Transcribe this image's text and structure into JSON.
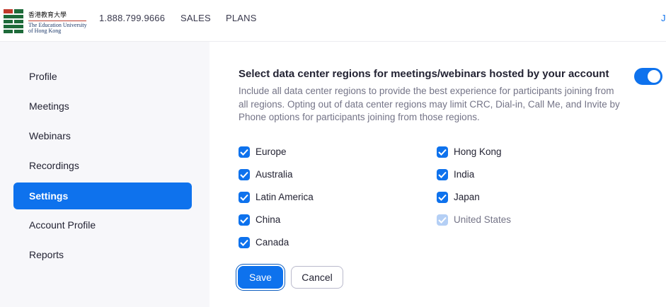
{
  "header": {
    "logo_cn": "香港教育大學",
    "logo_en_line1": "The Education University",
    "logo_en_line2": "of Hong Kong",
    "phone": "1.888.799.9666",
    "sales": "SALES",
    "plans": "PLANS",
    "user_initial": "J"
  },
  "sidebar": {
    "items": [
      {
        "label": "Profile",
        "active": false
      },
      {
        "label": "Meetings",
        "active": false
      },
      {
        "label": "Webinars",
        "active": false
      },
      {
        "label": "Recordings",
        "active": false
      },
      {
        "label": "Settings",
        "active": true
      },
      {
        "label": "Account Profile",
        "active": false
      },
      {
        "label": "Reports",
        "active": false
      }
    ]
  },
  "main": {
    "title": "Select data center regions for meetings/webinars hosted by your account",
    "description": "Include all data center regions to provide the best experience for participants joining from all regions. Opting out of data center regions may limit CRC, Dial-in, Call Me, and Invite by Phone options for participants joining from those regions.",
    "toggle_on": true,
    "regions_left": [
      {
        "label": "Europe",
        "checked": true,
        "disabled": false
      },
      {
        "label": "Australia",
        "checked": true,
        "disabled": false
      },
      {
        "label": "Latin America",
        "checked": true,
        "disabled": false
      },
      {
        "label": "China",
        "checked": true,
        "disabled": false
      },
      {
        "label": "Canada",
        "checked": true,
        "disabled": false
      }
    ],
    "regions_right": [
      {
        "label": "Hong Kong",
        "checked": true,
        "disabled": false
      },
      {
        "label": "India",
        "checked": true,
        "disabled": false
      },
      {
        "label": "Japan",
        "checked": true,
        "disabled": false
      },
      {
        "label": "United States",
        "checked": true,
        "disabled": true
      }
    ],
    "save_label": "Save",
    "cancel_label": "Cancel"
  },
  "colors": {
    "accent": "#0e72ed",
    "sidebar_bg": "#f7f7fa",
    "disabled_check": "#b4cff5"
  }
}
